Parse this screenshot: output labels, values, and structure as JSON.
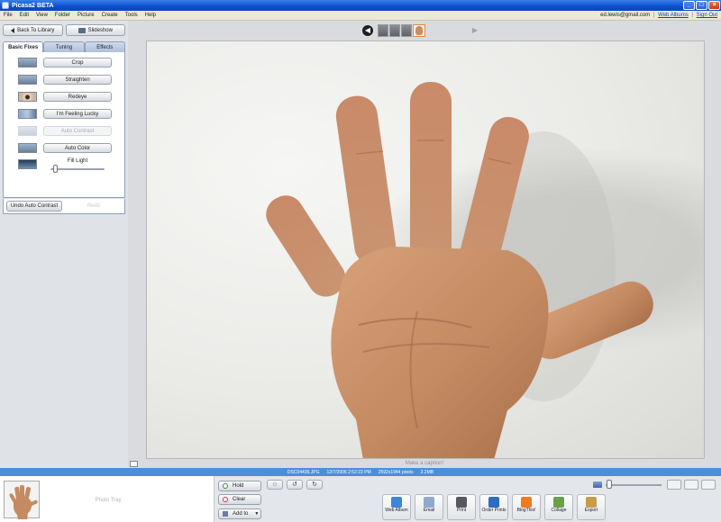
{
  "window": {
    "title": "Picasa2 BETA",
    "min": "_",
    "max": "□",
    "close": "×"
  },
  "menu": [
    "File",
    "Edit",
    "View",
    "Folder",
    "Picture",
    "Create",
    "Tools",
    "Help"
  ],
  "account": {
    "email": "ed.lewis@gmail.com",
    "web_albums": "Web Albums",
    "sign_out": "Sign Out"
  },
  "nav": {
    "back": "Back To Library",
    "slideshow": "Slideshow"
  },
  "tabs": [
    "Basic Fixes",
    "Tuning",
    "Effects"
  ],
  "fixes": {
    "crop": "Crop",
    "straighten": "Straighten",
    "redeye": "Redeye",
    "lucky": "I'm Feeling Lucky",
    "auto_contrast": "Auto Contrast",
    "auto_color": "Auto Color",
    "fill_light": "Fill Light",
    "fill_light_level": 0.05
  },
  "undo": {
    "undo": "Undo Auto Contrast",
    "redo": "Redo"
  },
  "caption": "Make a caption!",
  "status": {
    "filename": "DSC04436.JPG",
    "datetime": "12/7/2006 2:52:23 PM",
    "dimensions": "2592x1944 pixels",
    "size": "2.2MB"
  },
  "tray": {
    "label": "Photo Tray",
    "hold": "Hold",
    "clear": "Clear",
    "add_to": "Add to"
  },
  "zoom_level": 0.02,
  "actions": [
    {
      "label": "Web Album",
      "color": "#3a87d6"
    },
    {
      "label": "Email",
      "color": "#8fa9cc"
    },
    {
      "label": "Print",
      "color": "#55595f"
    },
    {
      "label": "Order Prints",
      "color": "#2f6cc2"
    },
    {
      "label": "BlogThis!",
      "color": "#f07a1f"
    },
    {
      "label": "Collage",
      "color": "#6aa048"
    },
    {
      "label": "Export",
      "color": "#c79c4a"
    }
  ],
  "colors": {
    "accent": "#4b8fd8",
    "title_bar": "#0b4fd0",
    "skin": "#c48a62"
  }
}
